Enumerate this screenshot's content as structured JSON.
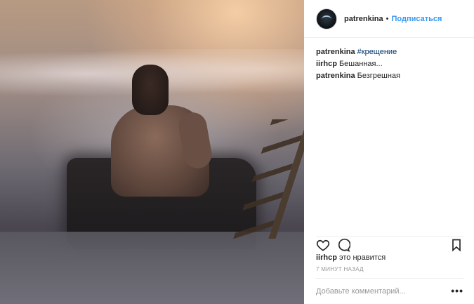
{
  "post": {
    "author": {
      "username": "patrenkina",
      "separator": "•",
      "follow_label": "Подписаться"
    },
    "comments": [
      {
        "author": "patrenkina",
        "text": "#крещение",
        "is_tag": true
      },
      {
        "author": "iirhcp",
        "text": "Бешанная...",
        "is_tag": false
      },
      {
        "author": "patrenkina",
        "text": "Безгрешная",
        "is_tag": false
      }
    ],
    "likes": {
      "liker": "iirhcp",
      "suffix": "это нравится"
    },
    "timestamp": "7 МИНУТ НАЗАД",
    "add_comment": {
      "placeholder": "Добавьте комментарий..."
    },
    "more_label": "•••"
  },
  "colors": {
    "link": "#3897f0",
    "tag": "#003569",
    "text": "#262626",
    "muted": "#999999"
  },
  "icons": {
    "like": "heart-icon",
    "comment": "speech-bubble-icon",
    "save": "bookmark-icon",
    "more": "ellipsis-icon"
  }
}
